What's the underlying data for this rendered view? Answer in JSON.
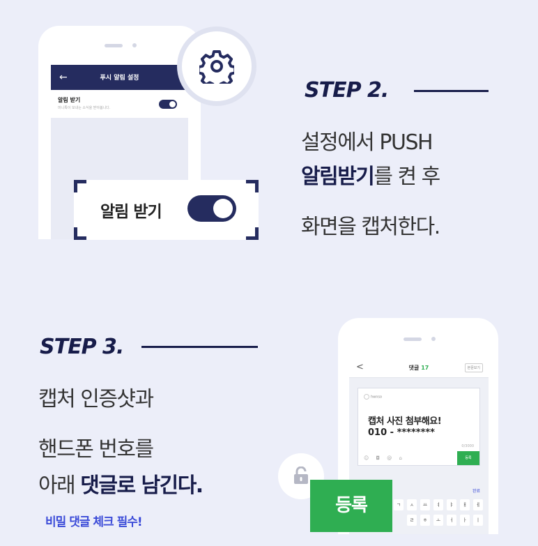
{
  "colors": {
    "navy": "#252c5f",
    "heading": "#171c4a",
    "green": "#2fae52",
    "accent_blue": "#3b4bd8",
    "background": "#eceef9"
  },
  "step2": {
    "title": "STEP 2.",
    "line1": "설정에서 PUSH",
    "line2_bold": "알림받기",
    "line2_rest": "를 켠 후",
    "line3": "화면을 캡처한다.",
    "phone": {
      "back_icon": "←",
      "header_title": "푸시 알림 설정",
      "row_title": "알림 받기",
      "row_subtitle": "머니톡이 보내는 소식을 받아봅니다.",
      "toggle_on": true
    },
    "gear_icon": "gear-icon",
    "focus_label": "알림 받기",
    "focus_toggle_on": true
  },
  "step3": {
    "title": "STEP 3.",
    "line1": "캡처 인증샷과",
    "line2": "핸드폰 번호를",
    "line3_pre": "아래 ",
    "line3_bold": "댓글로 남긴다.",
    "note": "비밀 댓글 체크 필수!",
    "phone": {
      "back_icon": "<",
      "header_title": "댓글",
      "header_count": "17",
      "view_button": "본문보기",
      "username": "hwnso",
      "comment_line1": "캡처 사진 첨부해요!",
      "comment_line2": "010 - ********",
      "char_count": "0/3000",
      "toolbar_icons": "☺ ◘ @ ⌂",
      "small_register": "등록",
      "done": "완료",
      "keys_row1": [
        "ㄱ",
        "ㅅ",
        "ㅛ",
        "ㅕ",
        "ㅑ",
        "ㅐ",
        "ㅔ"
      ],
      "keys_row2": [
        "ㄹ",
        "ㅎ",
        "ㅗ",
        "ㅓ",
        "ㅏ",
        "ㅣ"
      ]
    },
    "lock_icon": "unlock-icon",
    "register_label": "등록"
  }
}
